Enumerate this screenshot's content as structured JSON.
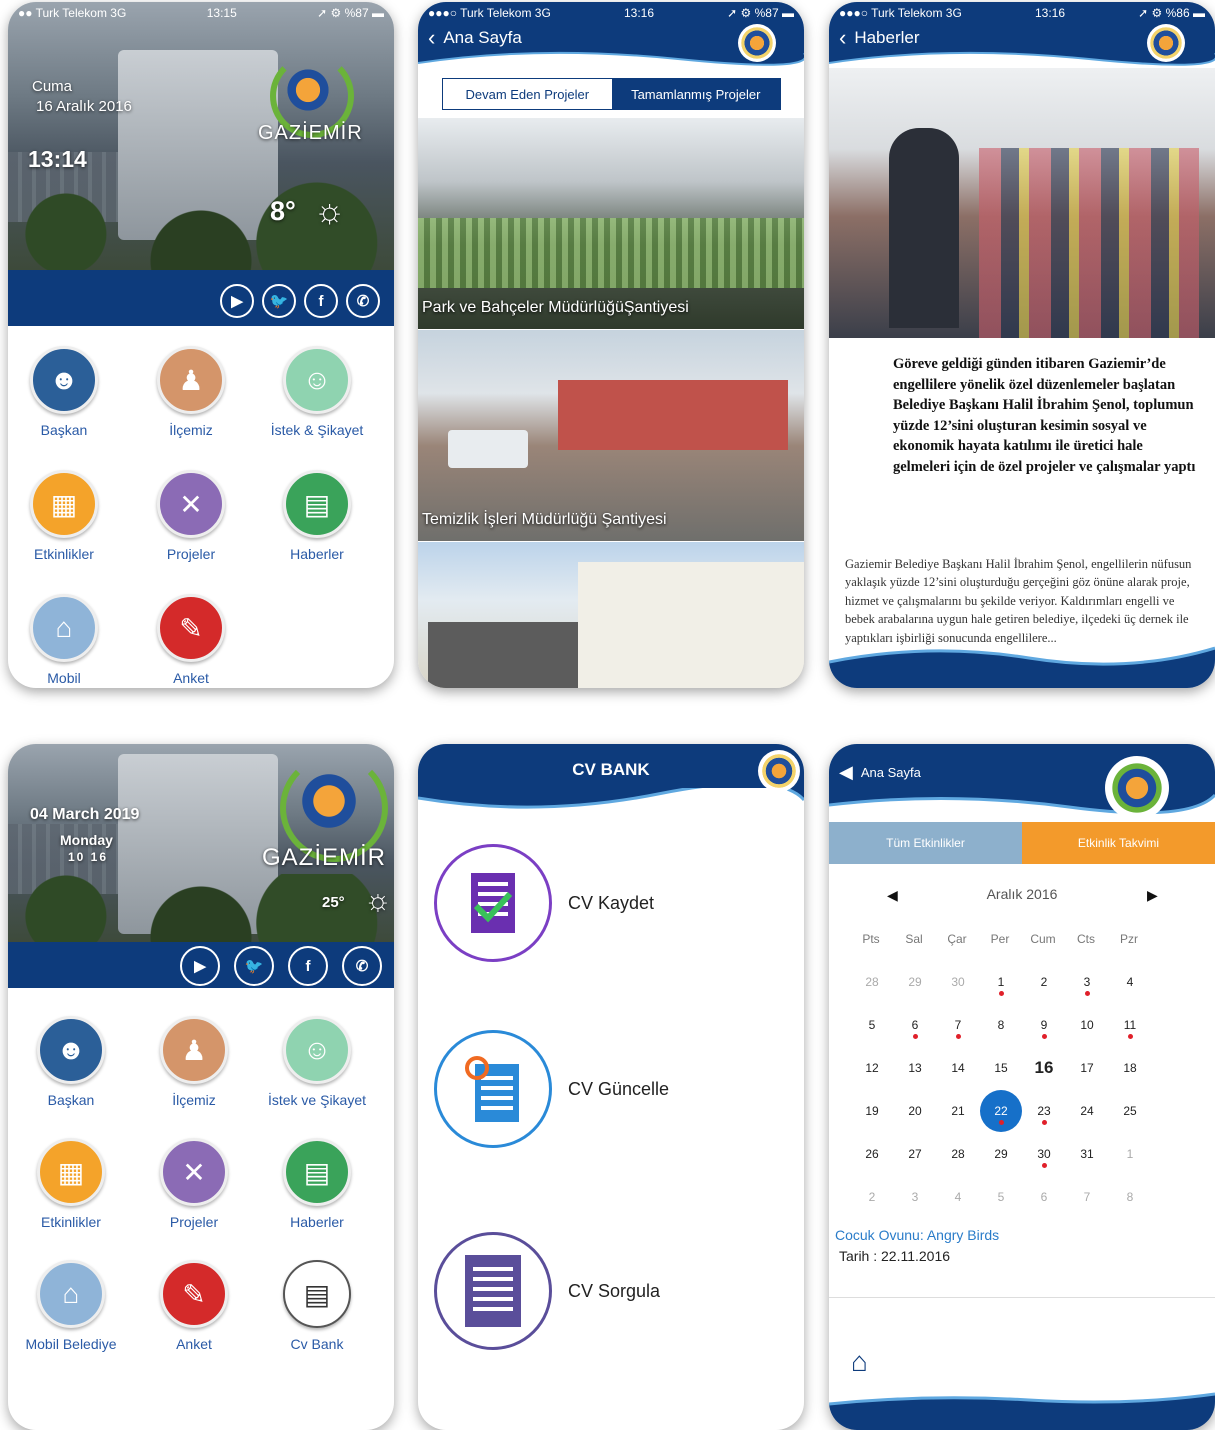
{
  "screen1": {
    "status": {
      "carrier": "●● Turk Telekom  3G",
      "time": "13:15",
      "battery": "➚ ⚙ %87 ▬"
    },
    "day": "Cuma",
    "date": "16 Aralık 2016",
    "clock": "13:14",
    "city": "GAZİEMİR",
    "temp": "8°",
    "tiles": [
      {
        "label": "Başkan",
        "icon": "person-icon",
        "color": "#2b5f98"
      },
      {
        "label": "İlçemiz",
        "icon": "statue-icon",
        "color": "#d4956a"
      },
      {
        "label": "İstek & Şikayet",
        "icon": "people-icon",
        "color": "#8fd3b0"
      },
      {
        "label": "Etkinlikler",
        "icon": "calendar-icon",
        "color": "#f4a32a"
      },
      {
        "label": "Projeler",
        "icon": "tools-icon",
        "color": "#8b6bb5"
      },
      {
        "label": "Haberler",
        "icon": "document-icon",
        "color": "#3aa35a"
      },
      {
        "label": "Mobil",
        "icon": "building-icon",
        "color": "#8fb4d8"
      },
      {
        "label": "Anket",
        "icon": "survey-icon",
        "color": "#d42a2a"
      }
    ]
  },
  "screen2": {
    "status": {
      "carrier": "●●●○ Turk Telekom  3G",
      "time": "13:16",
      "battery": "➚ ⚙ %87 ▬"
    },
    "nav": "Ana Sayfa",
    "tab_ongoing": "Devam Eden Projeler",
    "tab_done": "Tamamlanmış Projeler",
    "projects": [
      "Park ve Bahçeler MüdürlüğüŞantiyesi",
      "Temizlik İşleri Müdürlüğü Şantiyesi"
    ]
  },
  "screen3": {
    "status": {
      "carrier": "●●●○ Turk Telekom  3G",
      "time": "13:16",
      "battery": "➚ ⚙ %86 ▬"
    },
    "nav": "Haberler",
    "title": "Göreve geldiği günden itibaren Gaziemir’de engellilere yönelik özel düzenlemeler başlatan Belediye Başkanı Halil İbrahim Şenol, toplumun yüzde 12’sini oluşturan kesimin sosyal ve ekonomik hayata katılımı ile üretici hale gelmeleri için de özel projeler ve çalışmalar yaptı",
    "body": "Gaziemir Belediye Başkanı Halil İbrahim Şenol, engellilerin nüfusun yaklaşık yüzde 12’sini oluşturduğu gerçeğini göz önüne alarak proje, hizmet ve çalışmalarını bu şekilde veriyor. Kaldırımları engelli ve bebek arabalarına uygun hale getiren belediye, ilçedeki üç dernek ile yaptıkları işbirliği sonucunda engellilere..."
  },
  "screen4": {
    "date": "04 March 2019",
    "weekday": "Monday",
    "clock": "10 16",
    "city": "GAZİEMİR",
    "temp": "25°",
    "tiles": [
      {
        "label": "Başkan",
        "icon": "person-icon",
        "color": "#2b5f98"
      },
      {
        "label": "İlçemiz",
        "icon": "statue-icon",
        "color": "#d4956a"
      },
      {
        "label": "İstek ve Şikayet",
        "icon": "people-icon",
        "color": "#8fd3b0"
      },
      {
        "label": "Etkinlikler",
        "icon": "calendar-icon",
        "color": "#f4a32a"
      },
      {
        "label": "Projeler",
        "icon": "tools-icon",
        "color": "#8b6bb5"
      },
      {
        "label": "Haberler",
        "icon": "document-icon",
        "color": "#3aa35a"
      },
      {
        "label": "Mobil Belediye",
        "icon": "building-icon",
        "color": "#8fb4d8"
      },
      {
        "label": "Anket",
        "icon": "survey-icon",
        "color": "#d42a2a"
      },
      {
        "label": "Cv Bank",
        "icon": "cv-icon",
        "color": "#ffffff"
      }
    ]
  },
  "screen5": {
    "title": "CV BANK",
    "items": [
      {
        "label": "CV Kaydet",
        "icon": "cv-save-icon",
        "color": "#7b3fc4"
      },
      {
        "label": "CV Güncelle",
        "icon": "cv-update-icon",
        "color": "#2a8ad8"
      },
      {
        "label": "CV Sorgula",
        "icon": "cv-search-icon",
        "color": "#5a4e9a"
      }
    ]
  },
  "screen6": {
    "nav": "Ana Sayfa",
    "tab_all": "Tüm Etkinlikler",
    "tab_calendar": "Etkinlik Takvimi",
    "month": "Aralık 2016",
    "weekdays": [
      "Pts",
      "Sal",
      "Çar",
      "Per",
      "Cum",
      "Cts",
      "Pzr"
    ],
    "days": [
      [
        "28",
        "29",
        "30",
        "1",
        "2",
        "3",
        "4"
      ],
      [
        "5",
        "6",
        "7",
        "8",
        "9",
        "10",
        "11"
      ],
      [
        "12",
        "13",
        "14",
        "15",
        "16",
        "17",
        "18"
      ],
      [
        "19",
        "20",
        "21",
        "22",
        "23",
        "24",
        "25"
      ],
      [
        "26",
        "27",
        "28",
        "29",
        "30",
        "31",
        "1"
      ],
      [
        "2",
        "3",
        "4",
        "5",
        "6",
        "7",
        "8"
      ]
    ],
    "event_title": "Cocuk Ovunu: Angry Birds",
    "event_date": "Tarih : 22.11.2016"
  },
  "colors": {
    "navy": "#0d3b7c",
    "accent_orange": "#f39a2b",
    "tab_blue": "#8db0cc",
    "selected": "#1670c9",
    "event_dot": "#e0202a"
  }
}
